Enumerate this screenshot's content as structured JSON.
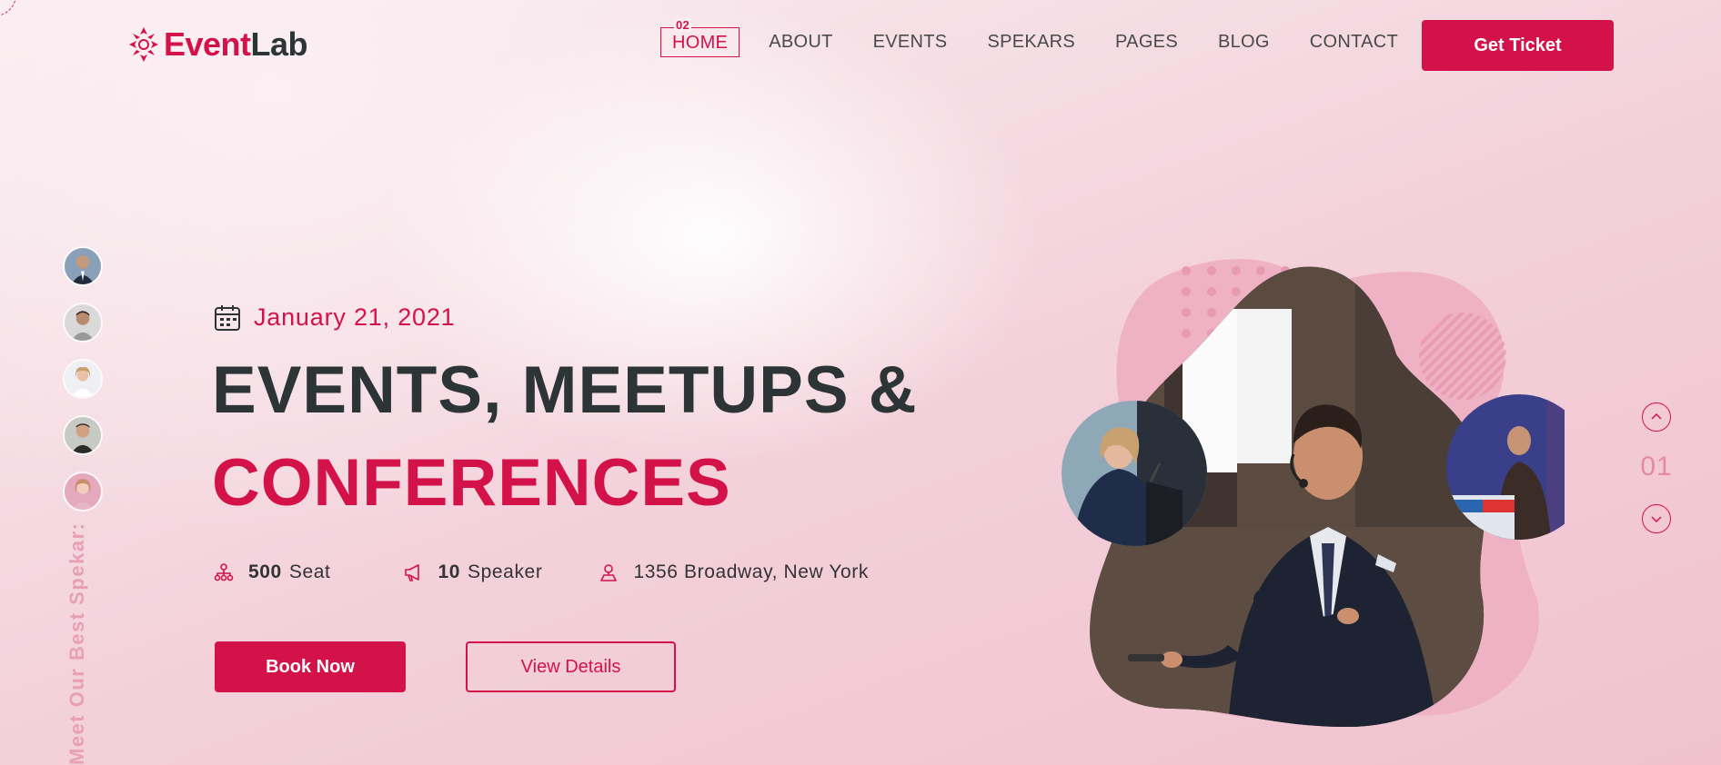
{
  "brand": {
    "name_part1": "Event",
    "name_part2": "Lab",
    "accent_color": "#d4124a"
  },
  "nav": {
    "items": [
      {
        "label": "HOME",
        "badge": "02",
        "active": true
      },
      {
        "label": "ABOUT"
      },
      {
        "label": "EVENTS"
      },
      {
        "label": "SPEKARS"
      },
      {
        "label": "PAGES"
      },
      {
        "label": "BLOG"
      },
      {
        "label": "CONTACT"
      }
    ],
    "cta": "Get Ticket"
  },
  "sidebar": {
    "vertical_label": "Meet Our Best Spekar:",
    "avatars": [
      "speaker-1",
      "speaker-2",
      "speaker-3",
      "speaker-4",
      "speaker-5"
    ]
  },
  "hero": {
    "date": "January 21, 2021",
    "headline_line1": "EVENTS, MEETUPS &",
    "headline_line2": "CONFERENCES",
    "stats": [
      {
        "icon": "sitemap-icon",
        "value": "500",
        "label": "Seat"
      },
      {
        "icon": "megaphone-icon",
        "value": "10",
        "label": "Speaker"
      },
      {
        "icon": "location-pin-icon",
        "value": "",
        "label": "1356 Broadway, New York"
      }
    ],
    "book_label": "Book Now",
    "details_label": "View Details"
  },
  "slider": {
    "current": "01"
  }
}
